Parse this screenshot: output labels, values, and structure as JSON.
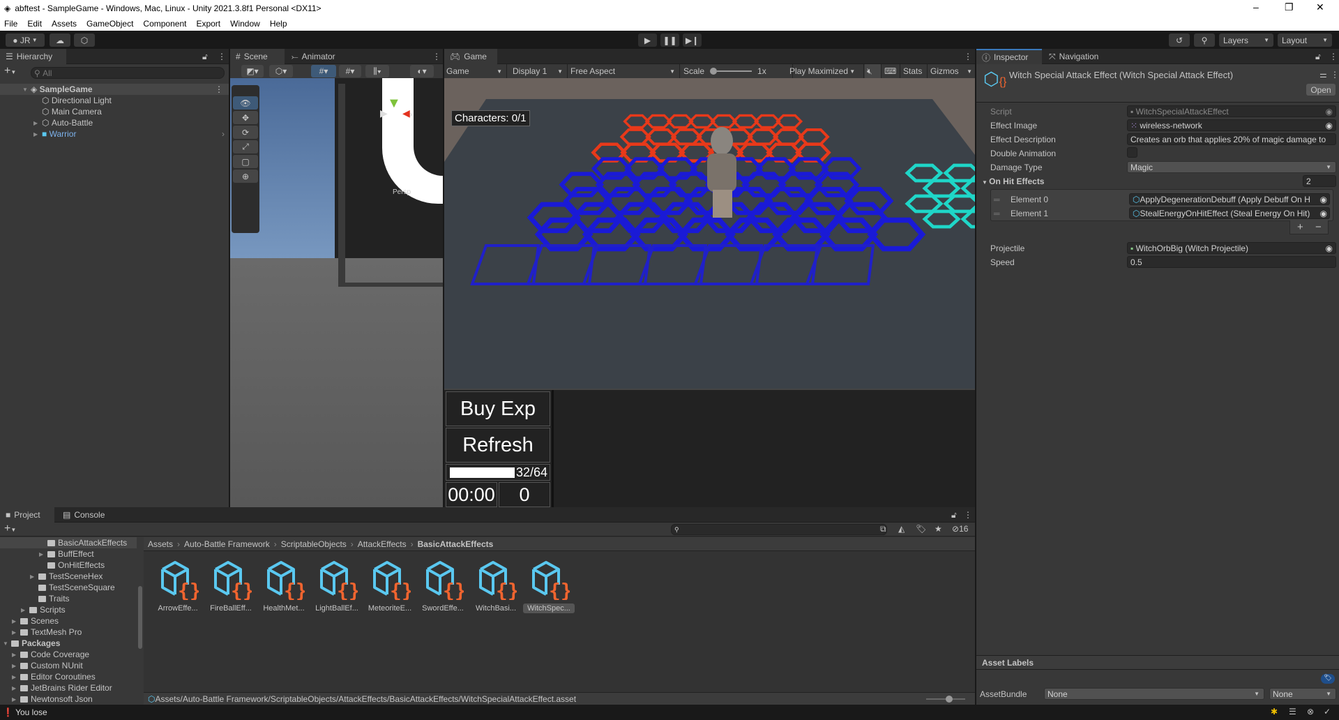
{
  "window": {
    "title": "abftest - SampleGame - Windows, Mac, Linux - Unity 2021.3.8f1 Personal <DX11>",
    "controls": [
      "minimize",
      "maximize",
      "close"
    ]
  },
  "menu": [
    "File",
    "Edit",
    "Assets",
    "GameObject",
    "Component",
    "Export",
    "Window",
    "Help"
  ],
  "toolbar": {
    "account": "JR",
    "layers": "Layers",
    "layout": "Layout"
  },
  "hierarchy": {
    "tab": "Hierarchy",
    "search_placeholder": "All",
    "scene": "SampleGame",
    "items": [
      "Directional Light",
      "Main Camera",
      "Auto-Battle",
      "Warrior"
    ]
  },
  "scene": {
    "tab": "Scene",
    "animator_tab": "Animator",
    "persp_label": "Persp"
  },
  "game": {
    "tab": "Game",
    "mode": "Game",
    "display": "Display 1",
    "aspect": "Free Aspect",
    "scale_label": "Scale",
    "scale_value": "1x",
    "play_mode": "Play Maximized",
    "stats": "Stats",
    "gizmos": "Gizmos",
    "characters": "Characters: 0/1",
    "buy_exp": "Buy Exp",
    "refresh": "Refresh",
    "exp_text": "32/64",
    "exp_fill": 1,
    "timer": "00:00",
    "gold": "0",
    "colors": {
      "enemy_tiles": "#e8391a",
      "player_tiles": "#1a1ad6",
      "bench_tiles": "#2020c8",
      "extra_tiles": "#1fd6c8"
    }
  },
  "inspector": {
    "tab": "Inspector",
    "nav_tab": "Navigation",
    "title": "Witch Special Attack Effect (Witch Special Attack Effect)",
    "open": "Open",
    "fields": {
      "script_label": "Script",
      "script": "WitchSpecialAttackEffect",
      "image_label": "Effect Image",
      "image": "wireless-network",
      "desc_label": "Effect Description",
      "desc": "Creates an orb that applies 20% of magic damage to",
      "double_label": "Double Animation",
      "double": false,
      "damage_label": "Damage Type",
      "damage": "Magic",
      "onhit_label": "On Hit Effects",
      "onhit_count": "2",
      "elements": [
        {
          "label": "Element 0",
          "value": "ApplyDegenerationDebuff (Apply Debuff On H"
        },
        {
          "label": "Element 1",
          "value": "StealEnergyOnHitEffect (Steal Energy On Hit)"
        }
      ],
      "projectile_label": "Projectile",
      "projectile": "WitchOrbBig (Witch Projectile)",
      "speed_label": "Speed",
      "speed": "0.5"
    },
    "asset_labels": "Asset Labels",
    "assetbundle_label": "AssetBundle",
    "assetbundle": "None",
    "variant": "None"
  },
  "project": {
    "tab": "Project",
    "console_tab": "Console",
    "hidden_count": "16",
    "tree": [
      {
        "name": "BasicAttackEffects",
        "depth": 4,
        "arrow": false,
        "selected": true
      },
      {
        "name": "BuffEffect",
        "depth": 4,
        "arrow": true
      },
      {
        "name": "OnHitEffects",
        "depth": 4,
        "arrow": false
      },
      {
        "name": "TestSceneHex",
        "depth": 3,
        "arrow": true
      },
      {
        "name": "TestSceneSquare",
        "depth": 3,
        "arrow": false
      },
      {
        "name": "Traits",
        "depth": 3,
        "arrow": false
      },
      {
        "name": "Scripts",
        "depth": 2,
        "arrow": true
      },
      {
        "name": "Scenes",
        "depth": 1,
        "arrow": true
      },
      {
        "name": "TextMesh Pro",
        "depth": 1,
        "arrow": true
      },
      {
        "name": "Packages",
        "depth": 0,
        "arrow": true,
        "open": true
      },
      {
        "name": "Code Coverage",
        "depth": 1,
        "arrow": true
      },
      {
        "name": "Custom NUnit",
        "depth": 1,
        "arrow": true
      },
      {
        "name": "Editor Coroutines",
        "depth": 1,
        "arrow": true
      },
      {
        "name": "JetBrains Rider Editor",
        "depth": 1,
        "arrow": true
      },
      {
        "name": "Newtonsoft Json",
        "depth": 1,
        "arrow": true
      }
    ],
    "breadcrumb": [
      "Assets",
      "Auto-Battle Framework",
      "ScriptableObjects",
      "AttackEffects",
      "BasicAttackEffects"
    ],
    "assets": [
      "ArrowEffe...",
      "FireBallEff...",
      "HealthMet...",
      "LightBallEf...",
      "MeteoriteE...",
      "SwordEffe...",
      "WitchBasi...",
      "WitchSpec..."
    ],
    "selected_path": "Assets/Auto-Battle Framework/ScriptableObjects/AttackEffects/BasicAttackEffects/WitchSpecialAttackEffect.asset"
  },
  "status": {
    "message": "You lose"
  }
}
